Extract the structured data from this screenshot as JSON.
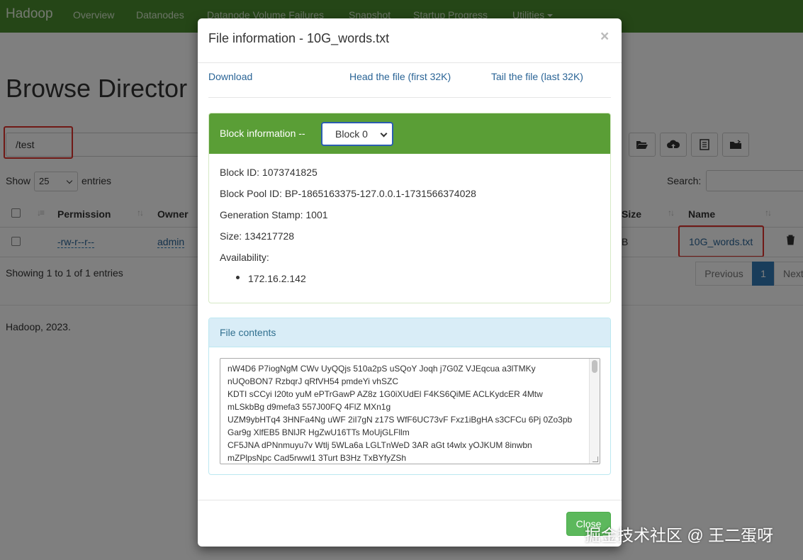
{
  "navbar": {
    "brand": "Hadoop",
    "items": [
      "Overview",
      "Datanodes",
      "Datanode Volume Failures",
      "Snapshot",
      "Startup Progress",
      "Utilities"
    ]
  },
  "page": {
    "title": "Browse Director",
    "path": "/test",
    "show_label": "Show",
    "show_value": "25",
    "entries_label": "entries",
    "search_label": "Search:",
    "columns": [
      "Permission",
      "Owner",
      "Size",
      "Name"
    ],
    "row": {
      "permission": "-rw-r--r--",
      "owner": "admin",
      "size": "B",
      "name": "10G_words.txt"
    },
    "showing": "Showing 1 to 1 of 1 entries",
    "pager": {
      "previous": "Previous",
      "page": "1",
      "next": "Next"
    },
    "footer": "Hadoop, 2023."
  },
  "modal": {
    "title": "File information - 10G_words.txt",
    "close_x": "×",
    "links": {
      "download": "Download",
      "head": "Head the file (first 32K)",
      "tail": "Tail the file (last 32K)"
    },
    "block_panel": {
      "heading": "Block information --",
      "selected_block": "Block 0",
      "block_id": "Block ID: 1073741825",
      "pool_id": "Block Pool ID: BP-1865163375-127.0.0.1-1731566374028",
      "gen_stamp": "Generation Stamp: 1001",
      "size": "Size: 134217728",
      "availability_label": "Availability:",
      "availability": [
        "172.16.2.142"
      ]
    },
    "contents_panel": {
      "heading": "File contents",
      "lines": [
        "nW4D6 P7iogNgM CWv UyQQjs 510a2pS uSQoY Joqh j7G0Z VJEqcua a3lTMKy",
        "nUQoBON7 RzbqrJ qRfVH54 pmdeYi vhSZC",
        "KDTI sCCyi I20to yuM ePTrGawP AZ8z 1G0iXUdEl F4KS6QiME ACLKydcER 4Mtw",
        "mLSkbBg d9mefa3 557J00FQ 4FlZ MXn1g",
        "UZM9ybHTq4 3HNFa4Ng uWF 2iI7gN z17S WfF6UC73vF Fxz1iBgHA s3CFCu 6Pj 0Zo3pb",
        "Gar9g XlfEB5 BNlJR HgZwU16TTs MoUjGLFllm",
        "CF5JNA dPNnmuyu7v Wtlj 5WLa6a LGLTnWeD 3AR aGt t4wlx yOJKUM 8inwbn",
        "mZPlpsNpc Cad5rwwl1 3Turt B3Hz TxBYfyZSh"
      ]
    },
    "close_button": "Close"
  },
  "watermark": "掘金技术社区 @ 王二蛋呀",
  "colors": {
    "navbar": "#4a8d2f",
    "success_heading": "#5a9e36",
    "info_heading": "#d9edf7",
    "highlight": "#e0322c",
    "link": "#2a6496"
  }
}
